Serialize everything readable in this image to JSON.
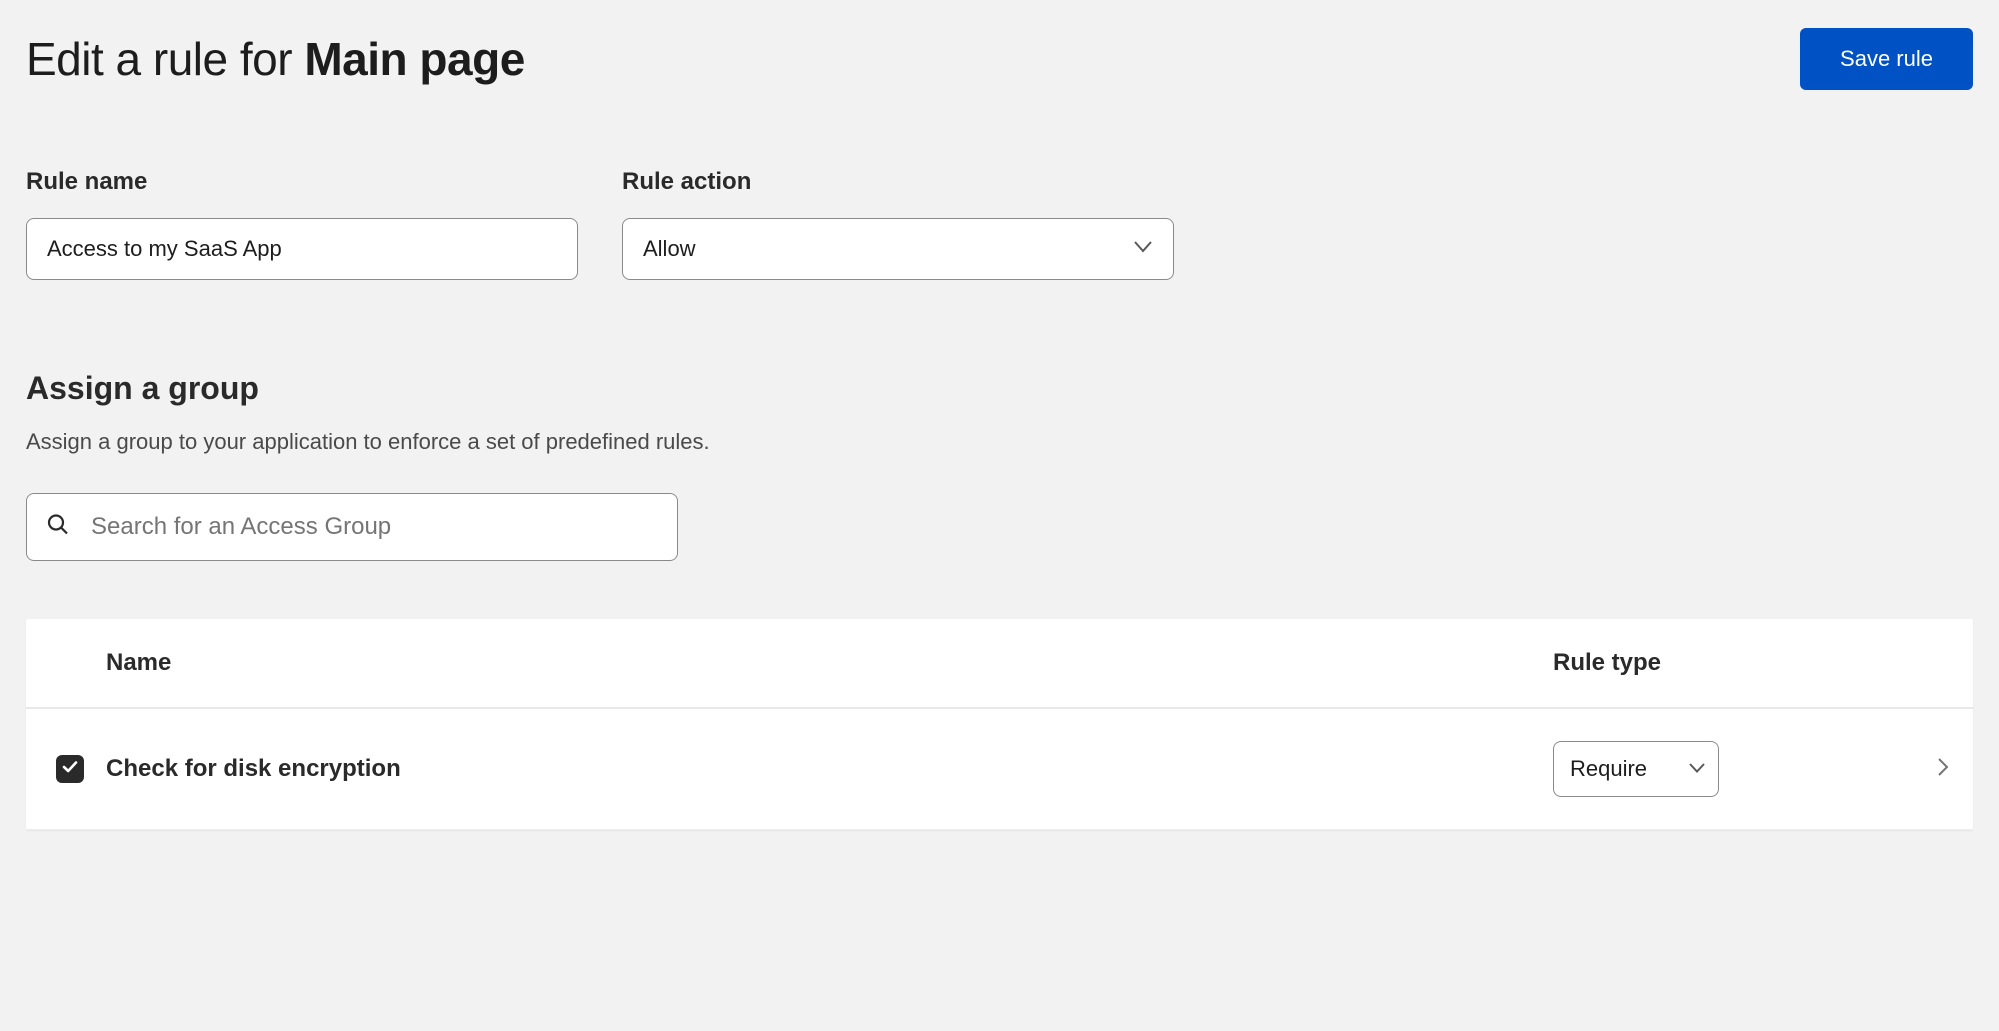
{
  "header": {
    "title_prefix": "Edit a rule for ",
    "title_bold": "Main page",
    "save_label": "Save rule"
  },
  "form": {
    "rule_name": {
      "label": "Rule name",
      "value": "Access to my SaaS App"
    },
    "rule_action": {
      "label": "Rule action",
      "value": "Allow"
    }
  },
  "assign_group": {
    "heading": "Assign a group",
    "description": "Assign a group to your application to enforce a set of predefined rules.",
    "search_placeholder": "Search for an Access Group"
  },
  "table": {
    "columns": {
      "name": "Name",
      "rule_type": "Rule type"
    },
    "rows": [
      {
        "checked": true,
        "name": "Check for disk encryption",
        "rule_type": "Require"
      }
    ]
  },
  "icons": {
    "search": "search-icon",
    "caret_down": "caret-down-icon",
    "chevron_right": "chevron-right-icon",
    "check": "check-icon"
  }
}
